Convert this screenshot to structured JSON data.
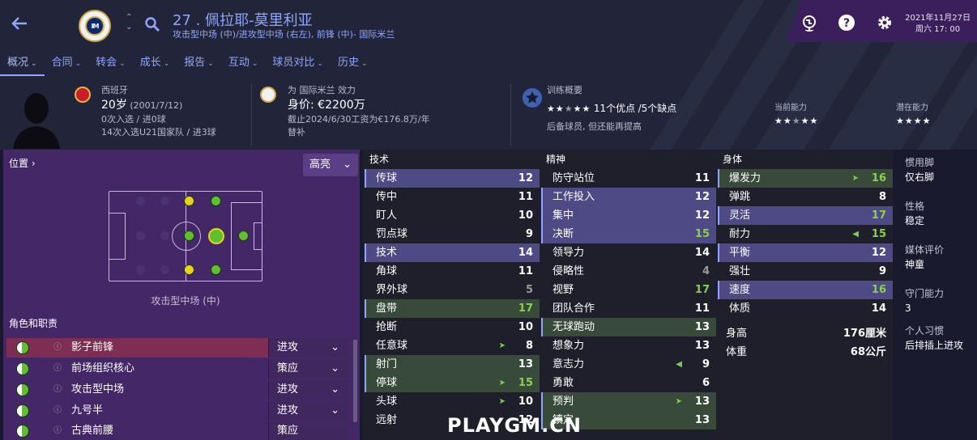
{
  "header": {
    "player_number_name": "27 . 佩拉耶-莫里利亚",
    "positions_club": "攻击型中场 (中)/进攻型中场 (右左), 前锋 (中)- 国际米兰",
    "date": "2021年11月27日",
    "time": "周六 17: 00",
    "club_crest_text": "IM"
  },
  "tabs": [
    {
      "label": "概况"
    },
    {
      "label": "合同"
    },
    {
      "label": "转会"
    },
    {
      "label": "成长"
    },
    {
      "label": "报告"
    },
    {
      "label": "互动"
    },
    {
      "label": "球员对比"
    },
    {
      "label": "历史"
    }
  ],
  "bio": {
    "nationality": "西班牙",
    "age": "20岁",
    "dob": "(2001/7/12)",
    "caps": "0次入选 / 进0球",
    "u21": "14次入选U21国家队 / 进3球"
  },
  "club": {
    "plays_for": "为 国际米兰 效力",
    "value": "身价: €2200万",
    "contract": "截止2024/6/30工资为€176.8万/年",
    "squad_status": "替补"
  },
  "training": {
    "title": "训练概要",
    "pros": "11个优点",
    "cons": "5个缺点",
    "sep": "/",
    "note": "后备球员, 但还能再提高",
    "current_ability": "当前能力",
    "potential_ability": "潜在能力",
    "ca_stars": 2.5,
    "pa_stars": 4,
    "summary_stars": 2.5
  },
  "positions": {
    "title": "位置",
    "highlight": "高亮",
    "role_label": "攻击型中场 (中)"
  },
  "roles": {
    "title": "角色和职责",
    "items": [
      {
        "name": "影子前锋",
        "duty": "进攻"
      },
      {
        "name": "前场组织核心",
        "duty": "策应"
      },
      {
        "name": "攻击型中场",
        "duty": "进攻"
      },
      {
        "name": "九号半",
        "duty": "进攻"
      },
      {
        "name": "古典前腰",
        "duty": "策应"
      }
    ]
  },
  "attrs": {
    "technical": {
      "title": "技术",
      "items": [
        {
          "n": "传球",
          "v": "12",
          "hl": 1
        },
        {
          "n": "传中",
          "v": "11"
        },
        {
          "n": "盯人",
          "v": "10"
        },
        {
          "n": "罚点球",
          "v": "9"
        },
        {
          "n": "技术",
          "v": "14",
          "hl": 1
        },
        {
          "n": "角球",
          "v": "11"
        },
        {
          "n": "界外球",
          "v": "5"
        },
        {
          "n": "盘带",
          "v": "17",
          "hl": 2
        },
        {
          "n": "抢断",
          "v": "10"
        },
        {
          "n": "任意球",
          "v": "8",
          "a": 1
        },
        {
          "n": "射门",
          "v": "13",
          "hl": 2
        },
        {
          "n": "停球",
          "v": "15",
          "hl": 2,
          "a": 1
        },
        {
          "n": "头球",
          "v": "10",
          "a": 1
        },
        {
          "n": "远射",
          "v": "12"
        }
      ]
    },
    "mental": {
      "title": "精神",
      "items": [
        {
          "n": "防守站位",
          "v": "11"
        },
        {
          "n": "工作投入",
          "v": "12",
          "hl": 1
        },
        {
          "n": "集中",
          "v": "12",
          "hl": 1
        },
        {
          "n": "决断",
          "v": "15",
          "hl": 1
        },
        {
          "n": "领导力",
          "v": "14"
        },
        {
          "n": "侵略性",
          "v": "4"
        },
        {
          "n": "视野",
          "v": "17"
        },
        {
          "n": "团队合作",
          "v": "11"
        },
        {
          "n": "无球跑动",
          "v": "13",
          "hl": 2
        },
        {
          "n": "想象力",
          "v": "13"
        },
        {
          "n": "意志力",
          "v": "9",
          "a": 2
        },
        {
          "n": "勇敢",
          "v": "6"
        },
        {
          "n": "预判",
          "v": "13",
          "hl": 2,
          "a": 1
        },
        {
          "n": "镇定",
          "v": "13",
          "hl": 2
        }
      ]
    },
    "physical": {
      "title": "身体",
      "items": [
        {
          "n": "爆发力",
          "v": "16",
          "hl": 2,
          "a": 1
        },
        {
          "n": "弹跳",
          "v": "8"
        },
        {
          "n": "灵活",
          "v": "17",
          "hl": 1
        },
        {
          "n": "耐力",
          "v": "15",
          "a": 2
        },
        {
          "n": "平衡",
          "v": "12",
          "hl": 1
        },
        {
          "n": "强壮",
          "v": "9"
        },
        {
          "n": "速度",
          "v": "16",
          "hl": 1
        },
        {
          "n": "体质",
          "v": "14"
        }
      ],
      "height_label": "身高",
      "height": "176厘米",
      "weight_label": "体重",
      "weight": "68公斤"
    }
  },
  "side": {
    "foot_k": "惯用脚",
    "foot_v": "仅右脚",
    "pers_k": "性格",
    "pers_v": "稳定",
    "media_k": "媒体评价",
    "media_v": "神童",
    "gk_k": "守门能力",
    "gk_v": "3",
    "habit_k": "个人习惯",
    "habit_v": "后排插上进攻"
  },
  "watermark": "PLAYGM.CN",
  "colors": {
    "accent": "#8fa6ff",
    "panel": "#432766",
    "high": "#8bd14b"
  }
}
